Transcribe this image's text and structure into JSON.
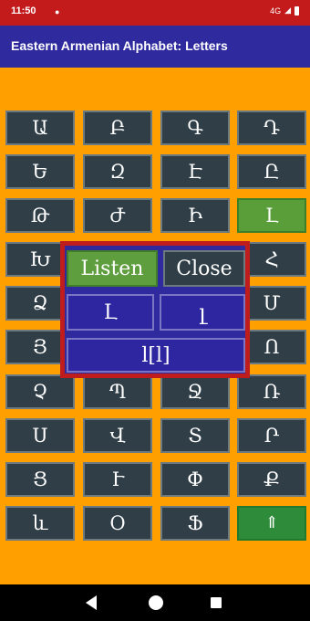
{
  "status": {
    "time": "11:50",
    "network": "4G"
  },
  "app": {
    "title": "Eastern Armenian Alphabet: Letters"
  },
  "letters": [
    "Ա",
    "Բ",
    "Գ",
    "Դ",
    "Ե",
    "Զ",
    "Է",
    "Ը",
    "Թ",
    "Ժ",
    "Ի",
    "Լ",
    "Խ",
    "",
    "",
    "Հ",
    "Ձ",
    "",
    "",
    "Մ",
    "Յ",
    "",
    "",
    "Ո",
    "Չ",
    "Պ",
    "Ջ",
    "Ռ",
    "Ս",
    "Վ",
    "Տ",
    "Ր",
    "Ց",
    "Ւ",
    "Փ",
    "Ք",
    "և",
    "Օ",
    "Ֆ",
    ""
  ],
  "selected_letter": "Լ",
  "scroll_up_icon": "⇑",
  "dialog": {
    "listen_label": "Listen",
    "close_label": "Close",
    "uppercase": "Լ",
    "lowercase": "լ",
    "pronunciation": "l[l]"
  },
  "colors": {
    "background": "#ffa000",
    "app_bar": "#2f2a9e",
    "status_bar": "#c31b1b",
    "key": "#303f47",
    "highlight": "#5a9e3a",
    "dialog_border": "#bf1d1d"
  }
}
